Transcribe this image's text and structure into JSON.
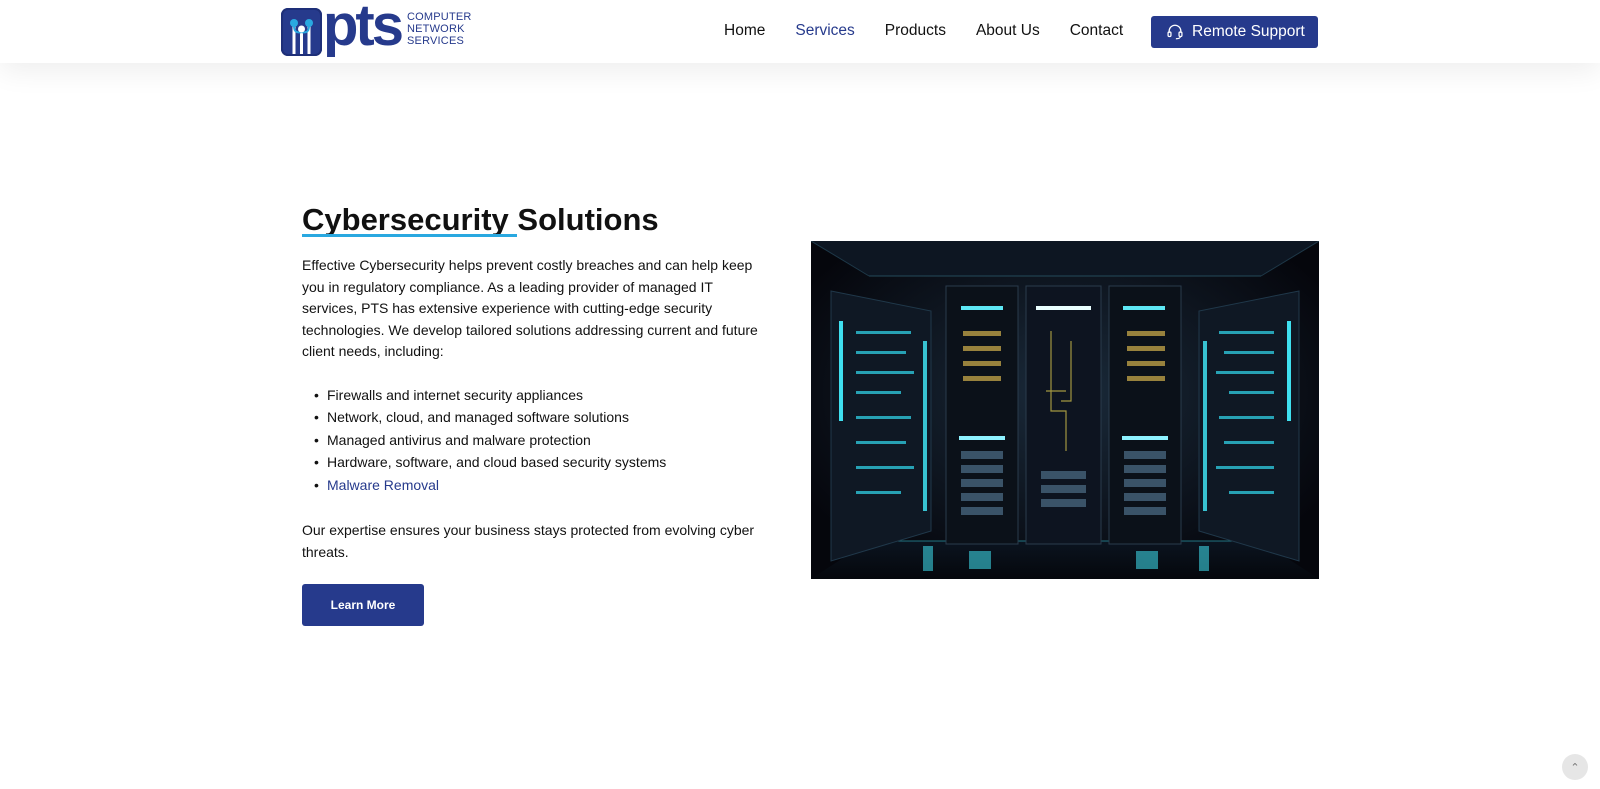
{
  "brand": {
    "wordmark": "pts",
    "subtitle_lines": [
      "COMPUTER",
      "NETWORK",
      "SERVICES"
    ],
    "logo_icon": "network-nodes-icon",
    "brand_color": "#263a8c",
    "accent_color": "#29a8e0"
  },
  "nav": {
    "items": [
      {
        "label": "Home",
        "active": false
      },
      {
        "label": "Services",
        "active": true
      },
      {
        "label": "Products",
        "active": false
      },
      {
        "label": "About Us",
        "active": false
      },
      {
        "label": "Contact",
        "active": false
      }
    ],
    "cta": {
      "label": "Remote Support",
      "icon": "headset-icon"
    }
  },
  "section": {
    "heading_underlined": "Cybersecurity",
    "heading_rest": "Solutions",
    "intro": "Effective Cybersecurity helps prevent costly breaches and can help keep you in regulatory compliance. As a leading provider of managed IT services, PTS has extensive experience with cutting-edge security technologies. We develop tailored solutions addressing current and future client needs, including:",
    "bullets": [
      "Firewalls and internet security appliances",
      "Network, cloud, and managed software solutions",
      "Managed antivirus and malware protection",
      "Hardware, software, and cloud based security systems"
    ],
    "bullet_link": "Malware Removal",
    "closing": "Our expertise ensures your business stays protected from evolving cyber threats.",
    "button": "Learn More"
  },
  "image": {
    "description_icon": "server-room-image"
  },
  "scroll_top": {
    "icon": "chevron-up-icon",
    "glyph": "⌃"
  }
}
